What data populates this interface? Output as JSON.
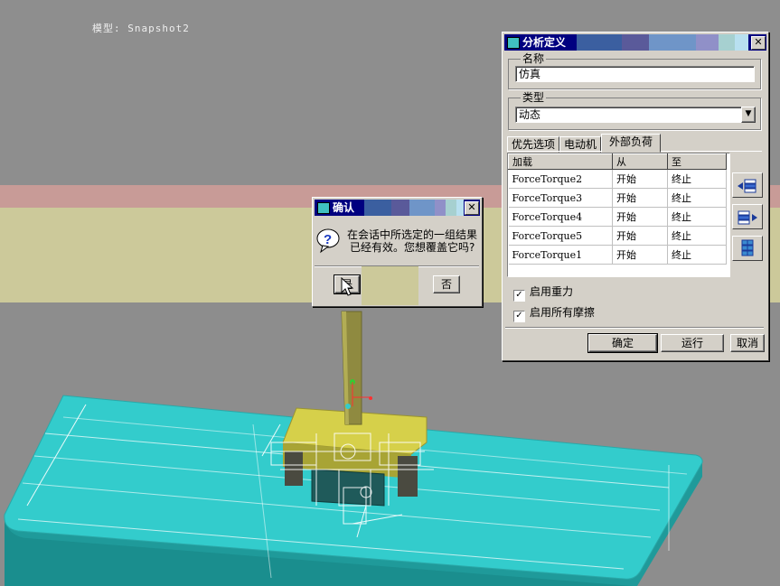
{
  "viewport": {
    "snapshot_label": "模型: Snapshot2",
    "colors": {
      "model_base": "#33cccc",
      "model_part": "#d6d04a",
      "background_band_pink": "#c89b97",
      "background_band_yellow": "#ccc99a"
    }
  },
  "analysis_dialog": {
    "title": "分析定义",
    "name_group": {
      "label": "名称",
      "value": "仿真"
    },
    "type_group": {
      "label": "类型",
      "selected": "动态"
    },
    "tabs": [
      {
        "label": "优先选项"
      },
      {
        "label": "电动机"
      },
      {
        "label": "外部负荷"
      }
    ],
    "active_tab": "外部负荷",
    "table": {
      "headers": [
        "加载",
        "从",
        "至"
      ],
      "rows": [
        {
          "load": "ForceTorque2",
          "from": "开始",
          "to": "终止"
        },
        {
          "load": "ForceTorque3",
          "from": "开始",
          "to": "终止"
        },
        {
          "load": "ForceTorque4",
          "from": "开始",
          "to": "终止"
        },
        {
          "load": "ForceTorque5",
          "from": "开始",
          "to": "终止"
        },
        {
          "load": "ForceTorque1",
          "from": "开始",
          "to": "终止"
        }
      ]
    },
    "side_icons": [
      "move-left-icon",
      "move-right-icon",
      "grid-select-all-icon"
    ],
    "checkboxes": [
      {
        "label": "启用重力",
        "checked": true
      },
      {
        "label": "启用所有摩擦",
        "checked": true
      }
    ],
    "buttons": {
      "ok": "确定",
      "run": "运行",
      "cancel": "取消"
    }
  },
  "confirm_dialog": {
    "title": "确认",
    "message_line1": "在会话中所选定的一组结果",
    "message_line2": "已经有效。您想覆盖它吗?",
    "icon": "question-icon",
    "buttons": {
      "yes": "是",
      "no": "否"
    }
  }
}
